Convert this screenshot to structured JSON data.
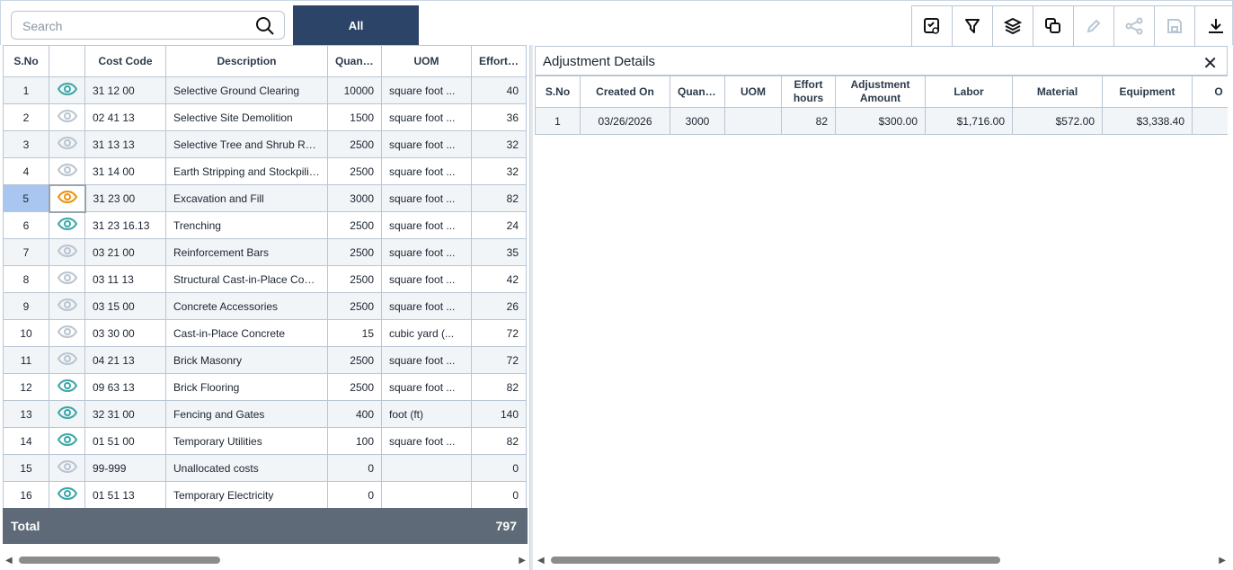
{
  "toolbar": {
    "search_placeholder": "Search",
    "filter_all": "All",
    "tools": [
      "view-checklist-icon",
      "filter-icon",
      "layers-icon",
      "copy-icon",
      "edit-icon",
      "share-icon",
      "save-icon",
      "download-icon"
    ]
  },
  "main_table": {
    "headers": [
      "S.No",
      "",
      "Cost Code",
      "Description",
      "Quantity",
      "UOM",
      "Effort hours"
    ],
    "rows": [
      {
        "sno": "1",
        "eye": "teal",
        "code": "31 12 00",
        "desc": "Selective Ground Clearing",
        "qty": "10000",
        "uom": "square foot ...",
        "hours": "40"
      },
      {
        "sno": "2",
        "eye": "gray",
        "code": "02 41 13",
        "desc": "Selective Site Demolition",
        "qty": "1500",
        "uom": "square foot ...",
        "hours": "36"
      },
      {
        "sno": "3",
        "eye": "gray",
        "code": "31 13 13",
        "desc": "Selective Tree and Shrub Rem...",
        "qty": "2500",
        "uom": "square foot ...",
        "hours": "32"
      },
      {
        "sno": "4",
        "eye": "gray",
        "code": "31 14 00",
        "desc": "Earth Stripping and Stockpiling",
        "qty": "2500",
        "uom": "square foot ...",
        "hours": "32"
      },
      {
        "sno": "5",
        "eye": "orange",
        "code": "31 23 00",
        "desc": "Excavation and Fill",
        "qty": "3000",
        "uom": "square foot ...",
        "hours": "82"
      },
      {
        "sno": "6",
        "eye": "teal",
        "code": "31 23 16.13",
        "desc": "Trenching",
        "qty": "2500",
        "uom": "square foot ...",
        "hours": "24"
      },
      {
        "sno": "7",
        "eye": "gray",
        "code": "03 21 00",
        "desc": "Reinforcement Bars",
        "qty": "2500",
        "uom": "square foot ...",
        "hours": "35"
      },
      {
        "sno": "8",
        "eye": "gray",
        "code": "03 11 13",
        "desc": "Structural Cast-in-Place Conc...",
        "qty": "2500",
        "uom": "square foot ...",
        "hours": "42"
      },
      {
        "sno": "9",
        "eye": "gray",
        "code": "03 15 00",
        "desc": "Concrete Accessories",
        "qty": "2500",
        "uom": "square foot ...",
        "hours": "26"
      },
      {
        "sno": "10",
        "eye": "gray",
        "code": "03 30 00",
        "desc": "Cast-in-Place Concrete",
        "qty": "15",
        "uom": "cubic yard (...",
        "hours": "72"
      },
      {
        "sno": "11",
        "eye": "gray",
        "code": "04 21 13",
        "desc": "Brick Masonry",
        "qty": "2500",
        "uom": "square foot ...",
        "hours": "72"
      },
      {
        "sno": "12",
        "eye": "teal",
        "code": "09 63 13",
        "desc": "Brick Flooring",
        "qty": "2500",
        "uom": "square foot ...",
        "hours": "82"
      },
      {
        "sno": "13",
        "eye": "teal",
        "code": "32 31 00",
        "desc": "Fencing and Gates",
        "qty": "400",
        "uom": "foot (ft)",
        "hours": "140"
      },
      {
        "sno": "14",
        "eye": "teal",
        "code": "01 51 00",
        "desc": "Temporary Utilities",
        "qty": "100",
        "uom": "square foot ...",
        "hours": "82"
      },
      {
        "sno": "15",
        "eye": "gray",
        "code": "99-999",
        "desc": "Unallocated costs",
        "qty": "0",
        "uom": "",
        "hours": "0"
      },
      {
        "sno": "16",
        "eye": "teal",
        "code": "01 51 13",
        "desc": "Temporary Electricity",
        "qty": "0",
        "uom": "",
        "hours": "0"
      }
    ],
    "total_label": "Total",
    "total_hours": "797"
  },
  "details": {
    "title": "Adjustment Details",
    "headers": [
      "S.No",
      "Created On",
      "Quantity",
      "UOM",
      "Effort hours",
      "Adjustment Amount",
      "Labor",
      "Material",
      "Equipment",
      "O"
    ],
    "rows": [
      {
        "sno": "1",
        "created": "03/26/2026",
        "qty": "3000",
        "uom": "",
        "hours": "82",
        "adj": "$300.00",
        "labor": "$1,716.00",
        "material": "$572.00",
        "equipment": "$3,338.40",
        "other": ""
      }
    ]
  },
  "colors": {
    "teal": "#3aa6a6",
    "gray": "#b8c4d0",
    "orange": "#f0900c",
    "navy": "#2b4468",
    "total_bg": "#5f6a78",
    "selected": "#a9c6f0"
  }
}
